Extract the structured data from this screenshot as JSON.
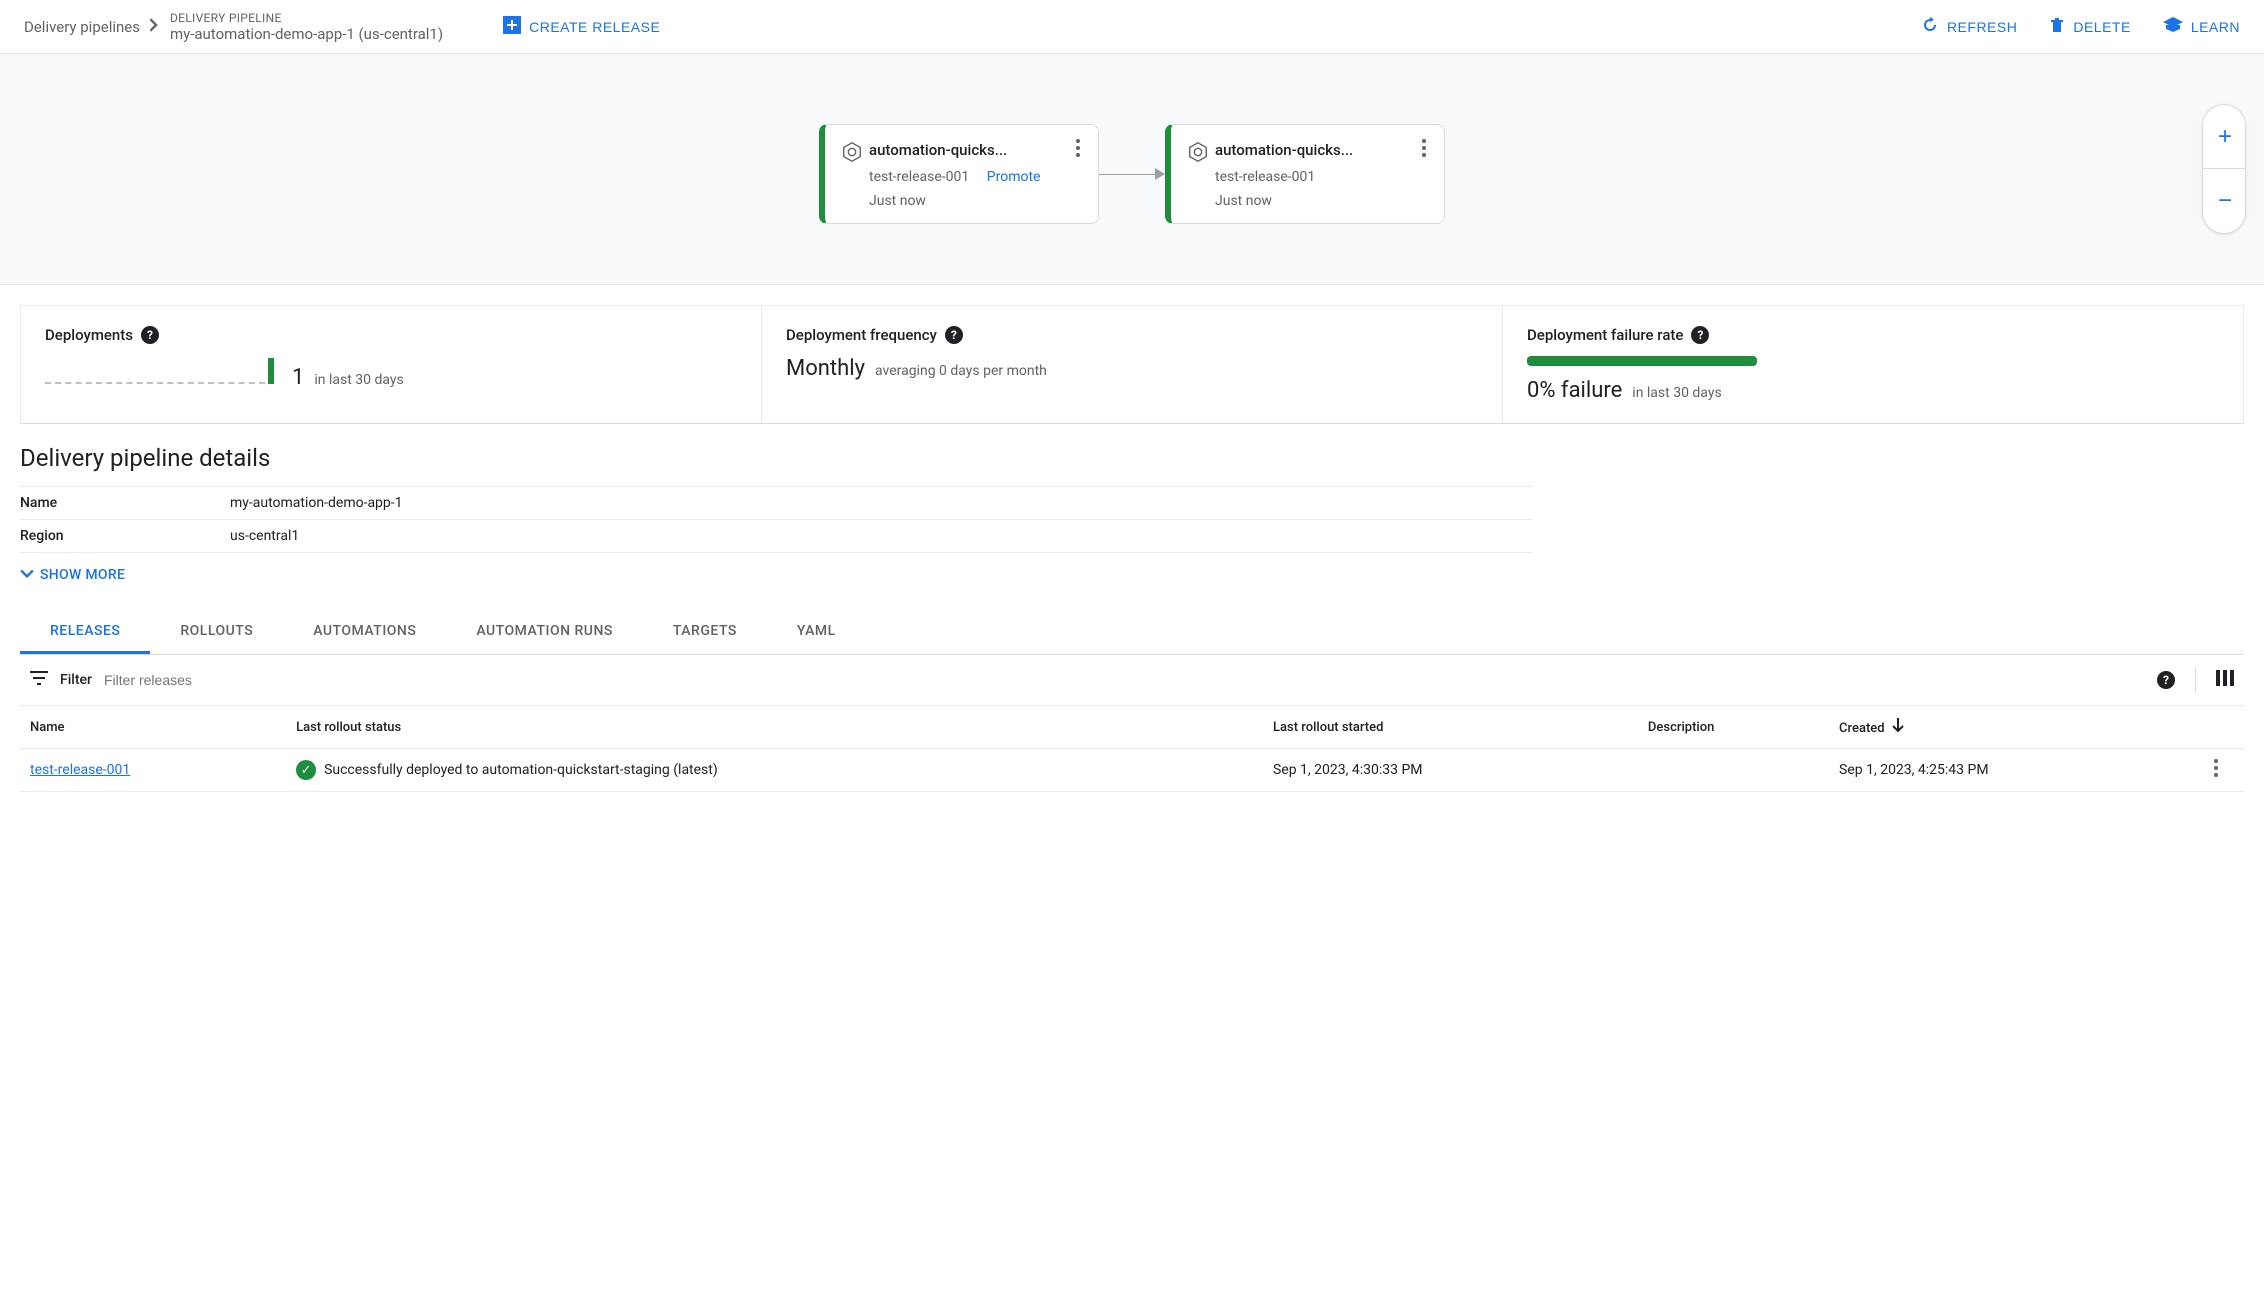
{
  "header": {
    "breadcrumb_root": "Delivery pipelines",
    "breadcrumb_label": "DELIVERY PIPELINE",
    "breadcrumb_title": "my-automation-demo-app-1 (us-central1)",
    "create_release": "CREATE RELEASE",
    "refresh": "REFRESH",
    "delete": "DELETE",
    "learn": "LEARN"
  },
  "stages": [
    {
      "title": "automation-quicks...",
      "release": "test-release-001",
      "promote": "Promote",
      "time": "Just now"
    },
    {
      "title": "automation-quicks...",
      "release": "test-release-001",
      "promote": "",
      "time": "Just now"
    }
  ],
  "metrics": {
    "deployments": {
      "title": "Deployments",
      "value": "1",
      "sub": "in last 30 days"
    },
    "frequency": {
      "title": "Deployment frequency",
      "value": "Monthly",
      "sub": "averaging 0 days per month"
    },
    "failure": {
      "title": "Deployment failure rate",
      "value": "0% failure",
      "sub": "in last 30 days"
    }
  },
  "details": {
    "heading": "Delivery pipeline details",
    "rows": [
      {
        "label": "Name",
        "value": "my-automation-demo-app-1"
      },
      {
        "label": "Region",
        "value": "us-central1"
      }
    ],
    "show_more": "SHOW MORE"
  },
  "tabs": [
    "RELEASES",
    "ROLLOUTS",
    "AUTOMATIONS",
    "AUTOMATION RUNS",
    "TARGETS",
    "YAML"
  ],
  "filter": {
    "label": "Filter",
    "placeholder": "Filter releases"
  },
  "table": {
    "headers": [
      "Name",
      "Last rollout status",
      "Last rollout started",
      "Description",
      "Created"
    ],
    "rows": [
      {
        "name": "test-release-001",
        "status": "Successfully deployed to automation-quickstart-staging (latest)",
        "started": "Sep 1, 2023, 4:30:33 PM",
        "description": "",
        "created": "Sep 1, 2023, 4:25:43 PM"
      }
    ]
  }
}
